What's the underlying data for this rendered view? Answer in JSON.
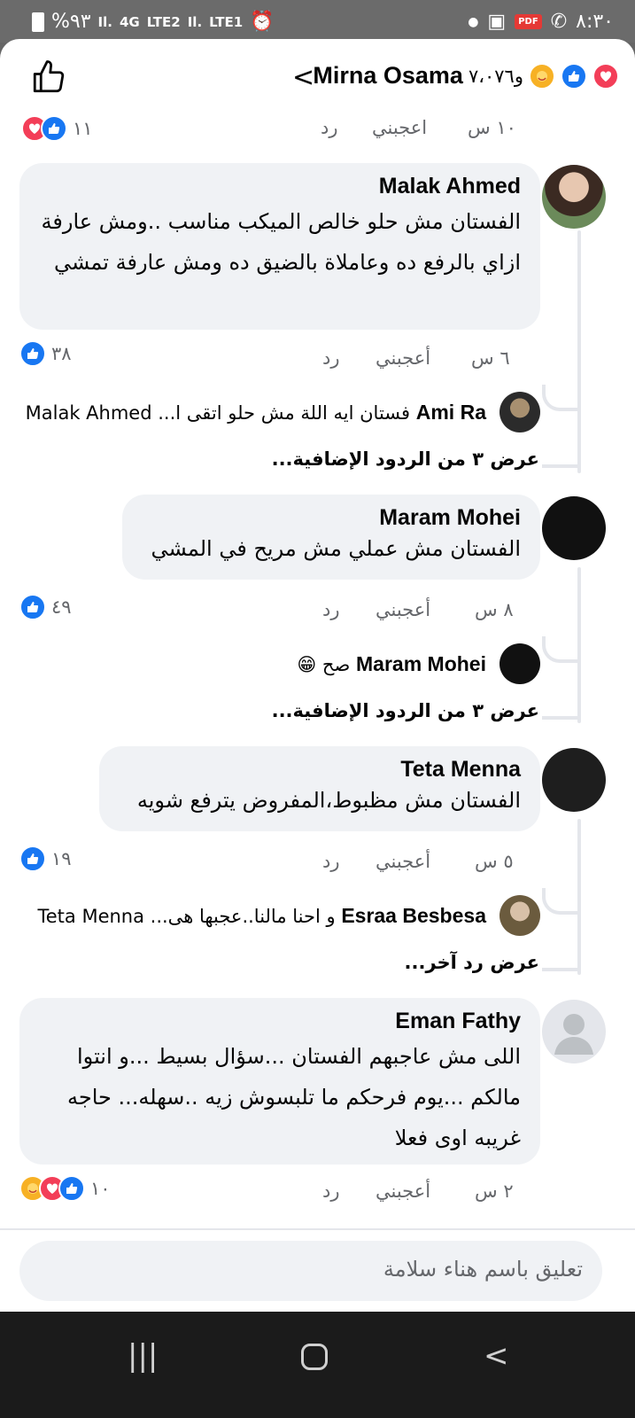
{
  "status_bar": {
    "battery": "%٩٣",
    "time": "٨:٣٠",
    "network_1": "4G",
    "lte2": "LTE2",
    "lte1": "LTE1",
    "pdf_badge": "PDF"
  },
  "header": {
    "title": "Mirna Osama",
    "reactions_count": "و٧،٠٧٦",
    "reaction_icons": [
      "care-icon",
      "like-icon",
      "love-icon"
    ]
  },
  "top_meta": {
    "time": "١٠ س",
    "like": "اعجبني",
    "reply": "رد",
    "reaction_count": "١١"
  },
  "comments": [
    {
      "name": "Malak Ahmed",
      "text": "الفستان مش حلو خالص الميكب مناسب ..ومش عارفة ازاي بالرفع ده وعاملاة بالضيق ده ومش عارفة تمشي",
      "time": "٦ س",
      "like": "أعجبني",
      "reply": "رد",
      "reaction_count": "٣٨",
      "reply_preview": {
        "name": "Ami Ra",
        "text": "فستان ايه اللة مش حلو اتقى ا... Malak Ahmed"
      },
      "more_replies": "عرض ٣ من الردود الإضافية..."
    },
    {
      "name": "Maram Mohei",
      "text": "الفستان مش عملي مش مريح في المشي",
      "time": "٨ س",
      "like": "أعجبني",
      "reply": "رد",
      "reaction_count": "٤٩",
      "reply_preview": {
        "name": "Maram Mohei",
        "text": "صح 😁"
      },
      "more_replies": "عرض ٣ من الردود الإضافية..."
    },
    {
      "name": "Teta Menna",
      "text": "الفستان مش مظبوط،المفروض يترفع شويه",
      "time": "٥ س",
      "like": "أعجبني",
      "reply": "رد",
      "reaction_count": "١٩",
      "reply_preview": {
        "name": "Esraa Besbesa",
        "text": "و احنا مالنا..عجبها هى... Teta Menna"
      },
      "more_replies": "عرض رد آخر..."
    },
    {
      "name": "Eman Fathy",
      "text": "اللى مش عاجبهم الفستان ...سؤال بسيط ...و انتوا مالكم ...يوم فرحكم ما تلبسوش زيه ..سهله... حاجه غريبه اوى فعلا",
      "time": "٢ س",
      "like": "أعجبني",
      "reply": "رد",
      "reaction_count": "١٠"
    }
  ],
  "composer": {
    "placeholder": "تعليق باسم هناء سلامة"
  }
}
